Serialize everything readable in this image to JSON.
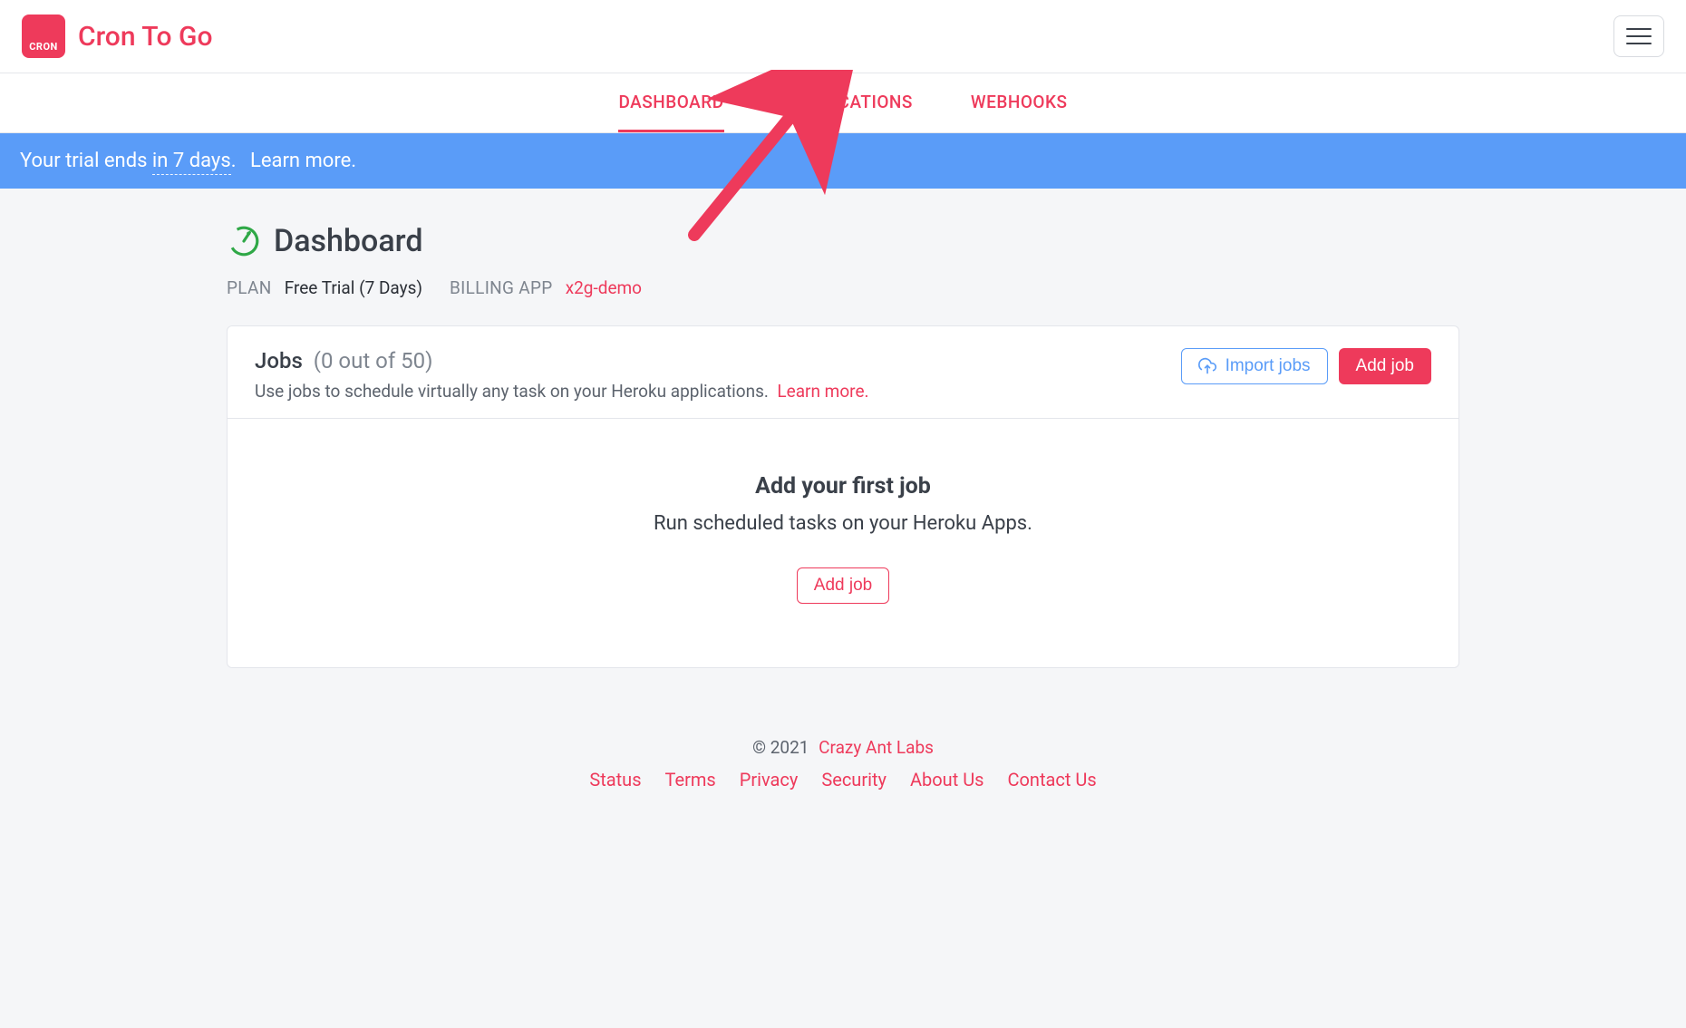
{
  "brand": {
    "logo_text": "CRON",
    "name": "Cron To Go"
  },
  "tabs": {
    "dashboard": "Dashboard",
    "notifications": "Notifications",
    "webhooks": "Webhooks"
  },
  "banner": {
    "prefix": "Your trial ends ",
    "days": "in 7 days",
    "suffix": ".",
    "learn": "Learn more."
  },
  "header": {
    "title": "Dashboard"
  },
  "meta": {
    "plan_label": "PLAN",
    "plan_value": "Free Trial (7 Days)",
    "billing_label": "BILLING APP",
    "billing_value": "x2g-demo"
  },
  "jobs": {
    "title": "Jobs",
    "count": "(0 out of 50)",
    "desc": "Use jobs to schedule virtually any task on your Heroku applications.",
    "learn": "Learn more.",
    "import_btn": "Import jobs",
    "add_btn": "Add job"
  },
  "empty": {
    "title": "Add your first job",
    "sub": "Run scheduled tasks on your Heroku Apps.",
    "cta": "Add job"
  },
  "footer": {
    "copyright": "© 2021",
    "company": "Crazy Ant Labs",
    "links": [
      "Status",
      "Terms",
      "Privacy",
      "Security",
      "About Us",
      "Contact Us"
    ]
  }
}
